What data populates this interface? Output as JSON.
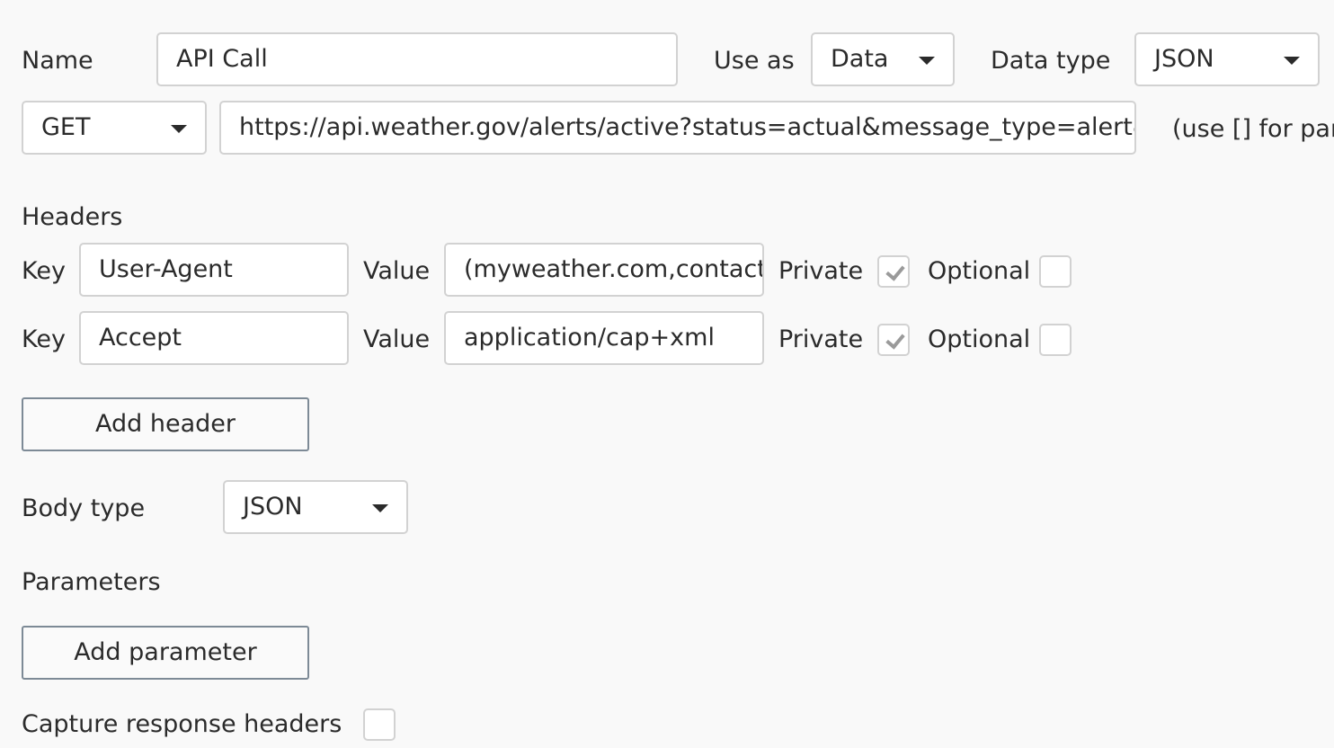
{
  "call": {
    "name_label": "Name",
    "name_value": "API Call",
    "use_as_label": "Use as",
    "use_as_value": "Data",
    "data_type_label": "Data type",
    "data_type_value": "JSON"
  },
  "request": {
    "method": "GET",
    "url": "https://api.weather.gov/alerts/active?status=actual&message_type=alert&region_type=land",
    "hint": "(use [] for parameters)"
  },
  "headers": {
    "title": "Headers",
    "key_label": "Key",
    "value_label": "Value",
    "private_label": "Private",
    "optional_label": "Optional",
    "rows": [
      {
        "key": "User-Agent",
        "value": "(myweather.com,contact@myweather.com)",
        "private": true,
        "optional": false
      },
      {
        "key": "Accept",
        "value": "application/cap+xml",
        "private": true,
        "optional": false
      }
    ],
    "add_label": "Add header"
  },
  "body": {
    "type_label": "Body type",
    "type_value": "JSON"
  },
  "parameters": {
    "title": "Parameters",
    "add_label": "Add parameter"
  },
  "capture": {
    "label": "Capture response headers"
  },
  "icons": {
    "dropdown": "caret-down-icon",
    "check": "checkmark-icon"
  },
  "colors": {
    "background": "#f9f9f9",
    "field_border": "#d2d2d2",
    "button_border": "#7d8a96",
    "check": "#9a9a9a"
  }
}
